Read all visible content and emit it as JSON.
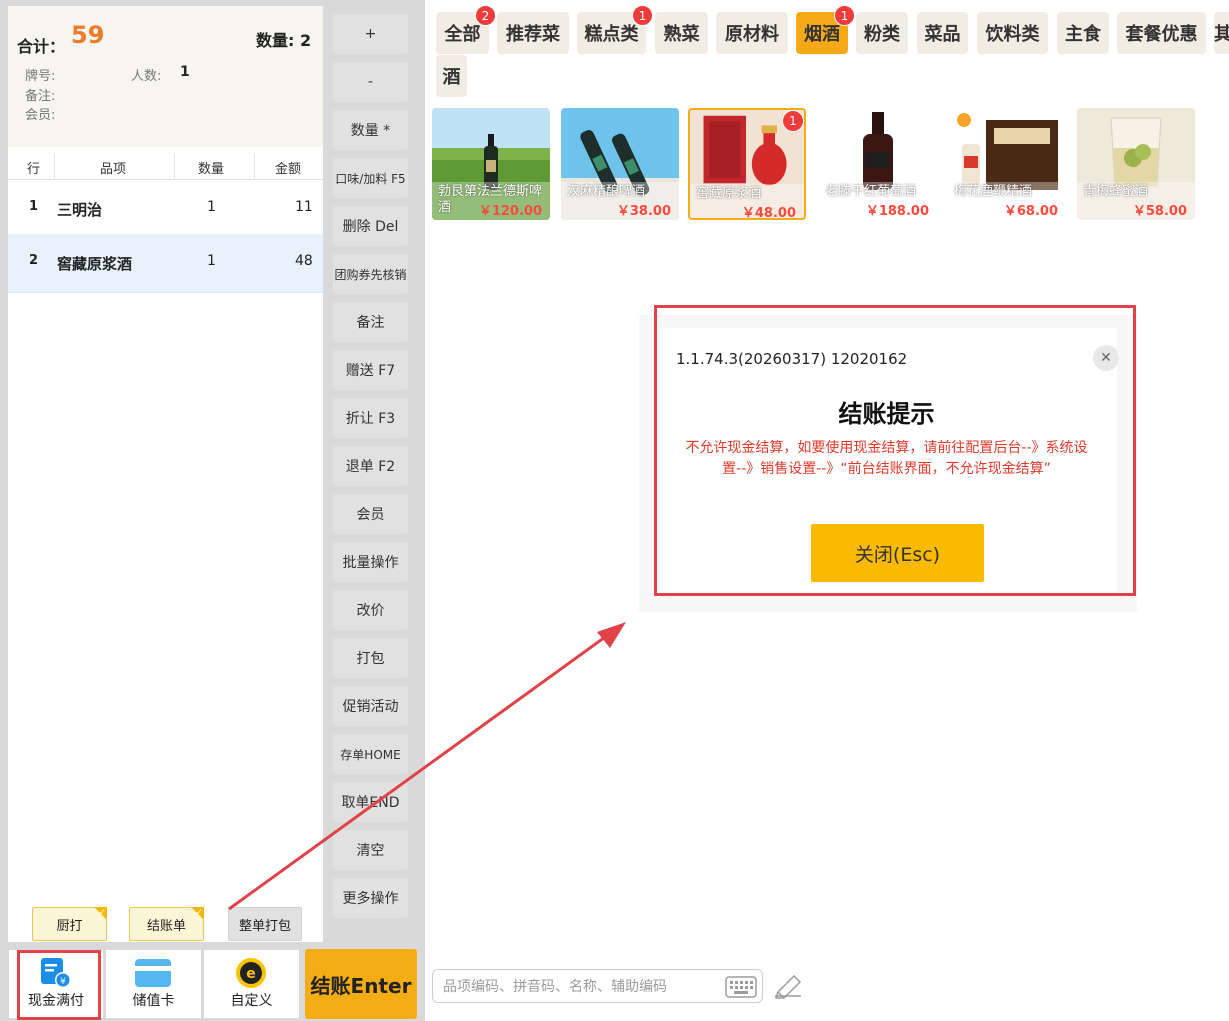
{
  "summary": {
    "total_label": "合计：",
    "total_value": "59",
    "count_label": "数量:",
    "count_value": "2",
    "table_label": "牌号:",
    "people_label": "人数:",
    "people_value": "1",
    "remark_label": "备注:",
    "member_label": "会员:"
  },
  "items_header": [
    "行",
    "品项",
    "数量",
    "金额"
  ],
  "items": [
    {
      "idx": "1",
      "name": "三明治",
      "qty": "1",
      "amount": "11"
    },
    {
      "idx": "2",
      "name": "窖藏原浆酒",
      "qty": "1",
      "amount": "48"
    }
  ],
  "tags": {
    "kitchen": "厨打",
    "bill": "结账单",
    "pack": "整单打包"
  },
  "functions": [
    "+",
    "-",
    "数量 *",
    "口味/加料 F5",
    "删除 Del",
    "团购券先核销",
    "备注",
    "赠送 F7",
    "折让 F3",
    "退单 F2",
    "会员",
    "批量操作",
    "改价",
    "打包",
    "促销活动",
    "存单HOME",
    "取单END",
    "清空",
    "更多操作"
  ],
  "payments": {
    "cash": "现金满付",
    "card": "储值卡",
    "custom": "自定义"
  },
  "checkout_label": "结账Enter",
  "categories": [
    {
      "label": "全部",
      "badge": "2"
    },
    {
      "label": "推荐菜",
      "badge": ""
    },
    {
      "label": "糕点类",
      "badge": "1"
    },
    {
      "label": "熟菜",
      "badge": ""
    },
    {
      "label": "原材料",
      "badge": ""
    },
    {
      "label": "烟酒",
      "badge": "1"
    },
    {
      "label": "粉类",
      "badge": ""
    },
    {
      "label": "菜品",
      "badge": ""
    },
    {
      "label": "饮料类",
      "badge": ""
    },
    {
      "label": "主食",
      "badge": ""
    },
    {
      "label": "套餐优惠",
      "badge": ""
    },
    {
      "label": "其",
      "badge": ""
    },
    {
      "label": "酒",
      "badge": ""
    }
  ],
  "products": [
    {
      "name": "勃艮第法兰德斯啤酒",
      "price": "￥120.00",
      "badge": ""
    },
    {
      "name": "汉麻精酿啤酒",
      "price": "￥38.00",
      "badge": ""
    },
    {
      "name": "窖藏原浆酒",
      "price": "￥48.00",
      "badge": "1"
    },
    {
      "name": "老滕干红葡萄酒",
      "price": "￥188.00",
      "badge": ""
    },
    {
      "name": "梅花鹿鞭精酒",
      "price": "￥68.00",
      "badge": ""
    },
    {
      "name": "青梅蜂蜜酒",
      "price": "￥58.00",
      "badge": ""
    }
  ],
  "dialog": {
    "version": "1.1.74.3(20260317) 12020162",
    "title": "结账提示",
    "message": "不允许现金结算，如要使用现金结算，请前往配置后台--》系统设置--》销售设置--》“前台结账界面，不允许现金结算”",
    "close_button": "关闭(Esc)"
  },
  "search": {
    "placeholder": "品项编码、拼音码、名称、辅助编码"
  },
  "colors": {
    "accent": "#f4ac14",
    "total": "#ee7a2a",
    "warning": "#e13a2a",
    "badge": "#ef3b3b",
    "annotation": "#e0424a"
  }
}
